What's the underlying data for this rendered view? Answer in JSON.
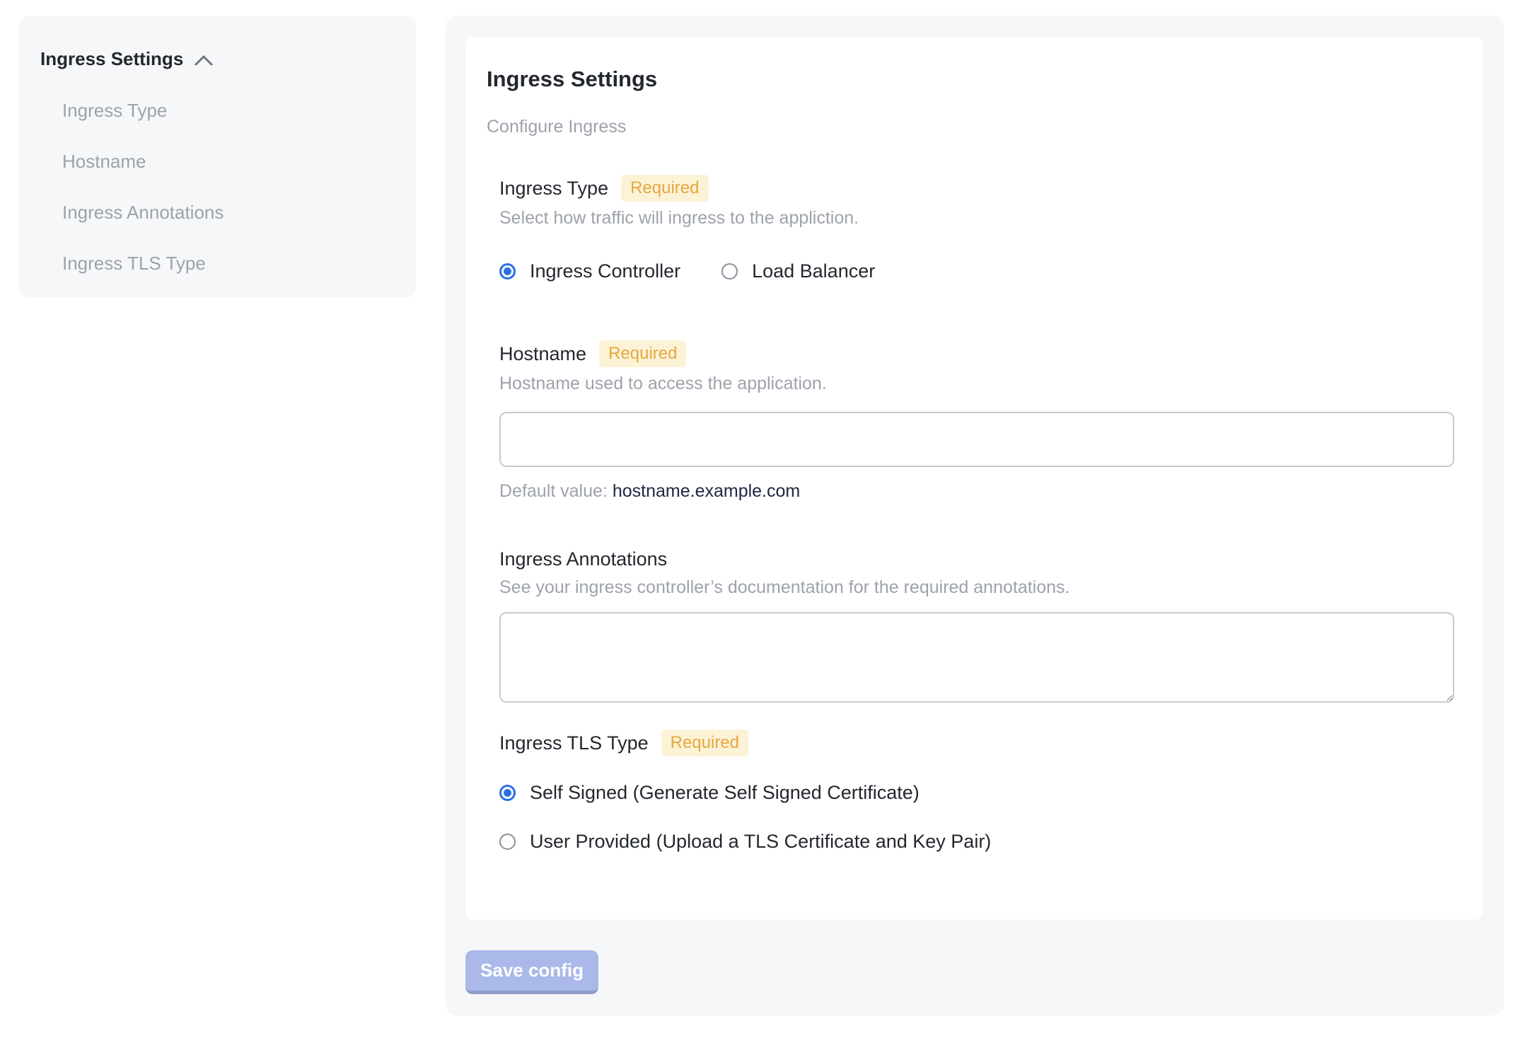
{
  "sidebar": {
    "header": "Ingress Settings",
    "items": [
      {
        "label": "Ingress Type"
      },
      {
        "label": "Hostname"
      },
      {
        "label": "Ingress Annotations"
      },
      {
        "label": "Ingress TLS Type"
      }
    ]
  },
  "main": {
    "title": "Ingress Settings",
    "subtitle": "Configure Ingress",
    "sections": {
      "ingress_type": {
        "label": "Ingress Type",
        "required_badge": "Required",
        "description": "Select how traffic will ingress to the appliction.",
        "options": [
          {
            "label": "Ingress Controller",
            "selected": true
          },
          {
            "label": "Load Balancer",
            "selected": false
          }
        ]
      },
      "hostname": {
        "label": "Hostname",
        "required_badge": "Required",
        "description": "Hostname used to access the application.",
        "input_value": "",
        "input_placeholder": "",
        "default_value_label": "Default value:",
        "default_value": "hostname.example.com"
      },
      "annotations": {
        "label": "Ingress Annotations",
        "description": "See your ingress controller’s documentation for the required annotations.",
        "textarea_value": "",
        "textarea_placeholder": ""
      },
      "tls": {
        "label": "Ingress TLS Type",
        "required_badge": "Required",
        "options": [
          {
            "label": "Self Signed (Generate Self Signed Certificate)",
            "selected": true
          },
          {
            "label": "User Provided (Upload a TLS Certificate and Key Pair)",
            "selected": false
          }
        ]
      }
    },
    "save_button_label": "Save config"
  },
  "colors": {
    "accent_blue": "#2b6fe6",
    "badge_bg": "#fcf2d6",
    "badge_text": "#e4a83e",
    "panel_bg": "#f6f7f9",
    "save_button_bg": "#aab9ea",
    "save_button_edge": "#8e9dca",
    "muted_text": "#9da2ab",
    "default_value_text": "#1c2742"
  }
}
